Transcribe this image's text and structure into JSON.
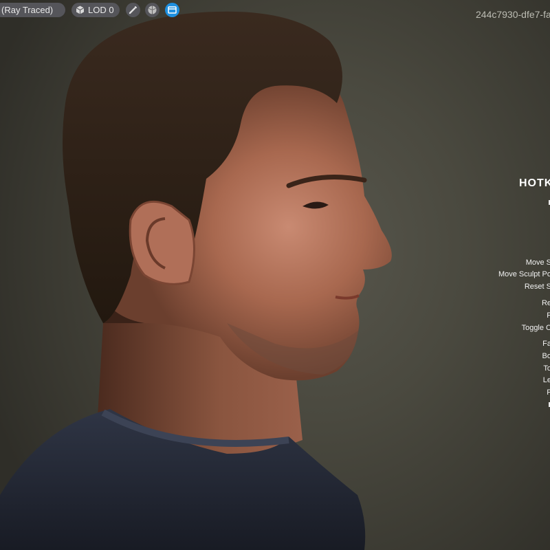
{
  "toolbar": {
    "render_mode": "(Ray Traced)",
    "lod_label": "LOD 0",
    "icons": [
      "cube-icon",
      "wrench-icon",
      "sphere-icon",
      "panel-icon"
    ],
    "active_button_color": "#1e8fe0"
  },
  "asset_id": "244c7930-dfe7-fa",
  "hotkeys": {
    "title": "HOTK",
    "items": [
      "Move S",
      "Move Sculpt Po",
      "Reset S",
      "Re",
      "F",
      "Toggle C",
      "Fa",
      "Bo",
      "To",
      "Le",
      "F"
    ]
  },
  "colors": {
    "background": "#4a493f",
    "pill": "#55555a",
    "overlay_text": "#ffffff"
  }
}
